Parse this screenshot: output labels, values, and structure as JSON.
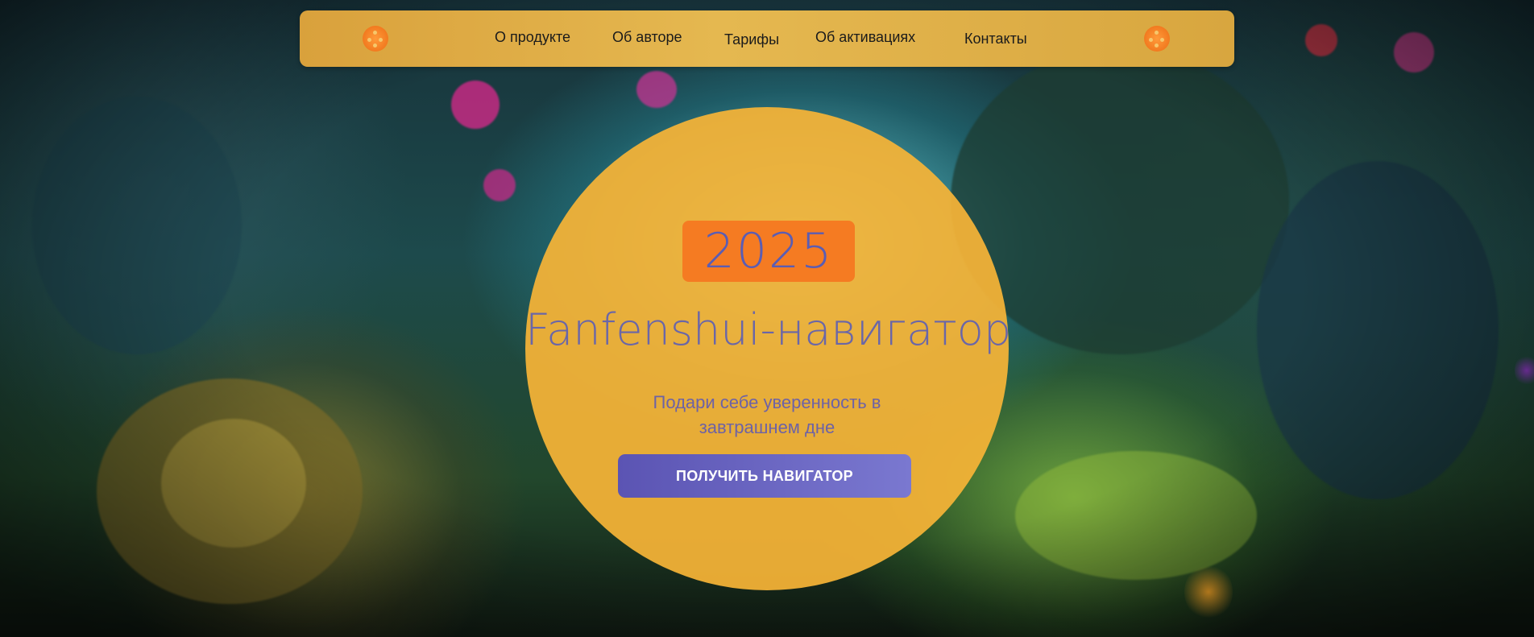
{
  "nav": {
    "links": [
      {
        "label": "О продукте"
      },
      {
        "label": "Об авторе"
      },
      {
        "label": "Тарифы"
      },
      {
        "label": "Об активациях"
      },
      {
        "label": "Контакты"
      }
    ],
    "logo_icon": "fengshui-logo-icon",
    "bar_color": "#e0ad47",
    "logo_color": "#f57b22"
  },
  "hero": {
    "year": "2025",
    "title": "Fanfenshui-навигатор",
    "subtitle_line1": "Подари себе уверенность в",
    "subtitle_line2": "завтрашнем дне",
    "cta_label": "ПОЛУЧИТЬ НАВИГАТОР",
    "circle_color": "#f6b437",
    "badge_color": "#f57b22",
    "accent_color": "#6a66a8",
    "button_color": "#5b54b3"
  },
  "background": {
    "description_icon": "fantasy-jungle-background"
  }
}
